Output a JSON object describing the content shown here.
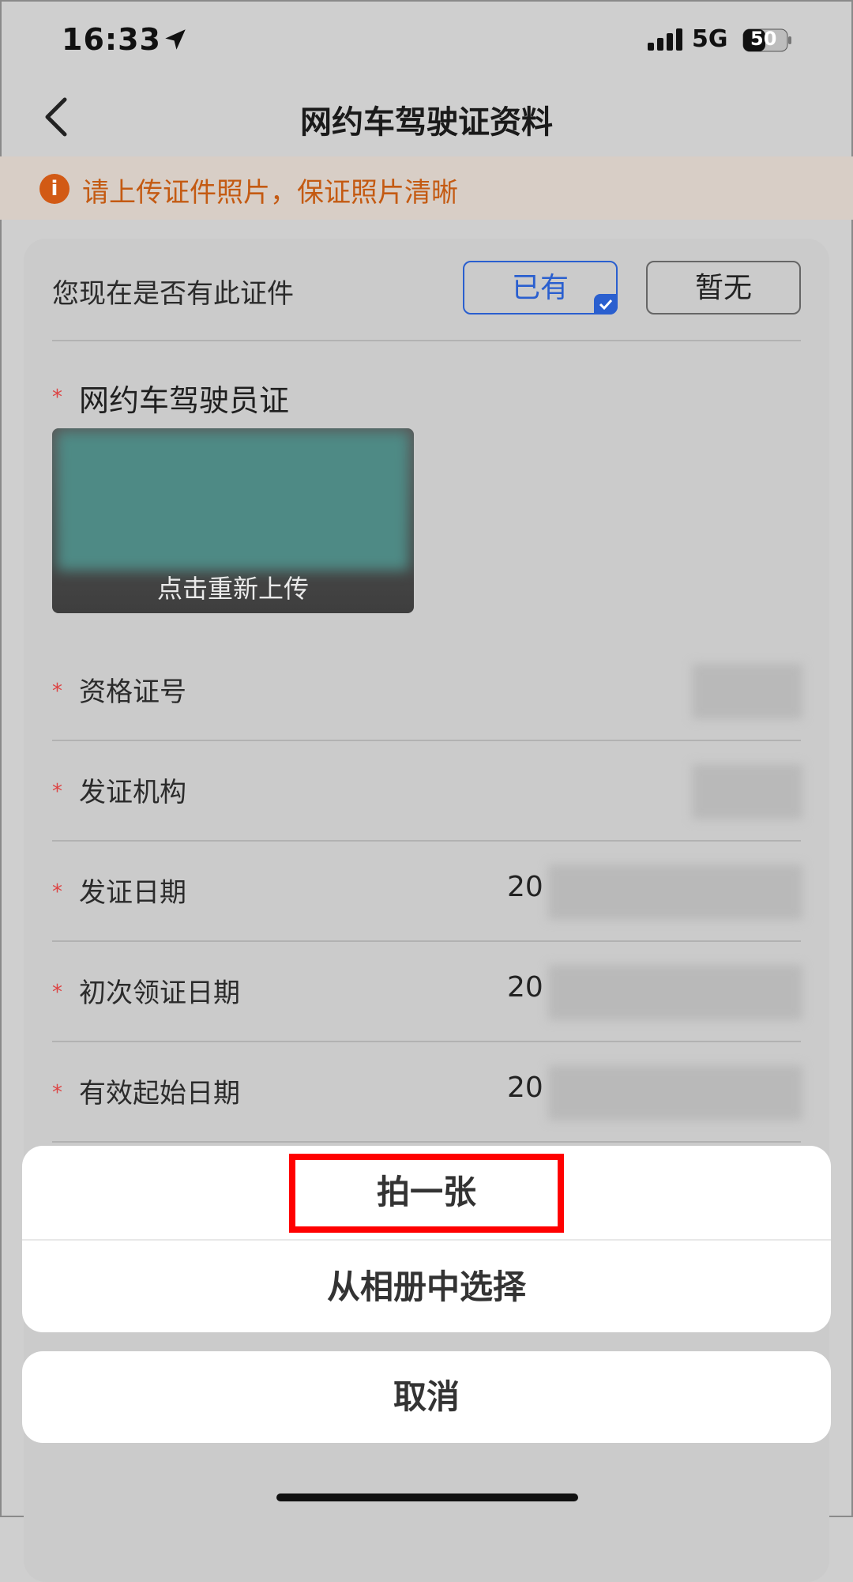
{
  "status_bar": {
    "time": "16:33",
    "network": "5G",
    "battery": "50"
  },
  "nav": {
    "title": "网约车驾驶证资料",
    "back_icon": "chevron-left-icon"
  },
  "notice": {
    "text": "请上传证件照片，保证照片清晰",
    "icon": "info-icon",
    "color": "#c45a12"
  },
  "question": {
    "label": "您现在是否有此证件",
    "options": [
      "已有",
      "暂无"
    ],
    "selected": "已有"
  },
  "certificate": {
    "required_mark": "*",
    "title": "网约车驾驶员证",
    "reupload_label": "点击重新上传"
  },
  "fields": [
    {
      "label": "资格证号",
      "value": ""
    },
    {
      "label": "发证机构",
      "value": ""
    },
    {
      "label": "发证日期",
      "value": "20"
    },
    {
      "label": "初次领证日期",
      "value": "20"
    },
    {
      "label": "有效起始日期",
      "value": "20"
    }
  ],
  "action_sheet": {
    "items": [
      "拍一张",
      "从相册中选择"
    ],
    "cancel": "取消"
  },
  "colors": {
    "accent": "#2a5fcf",
    "required": "#dd4444",
    "highlight": "#ff0000"
  }
}
